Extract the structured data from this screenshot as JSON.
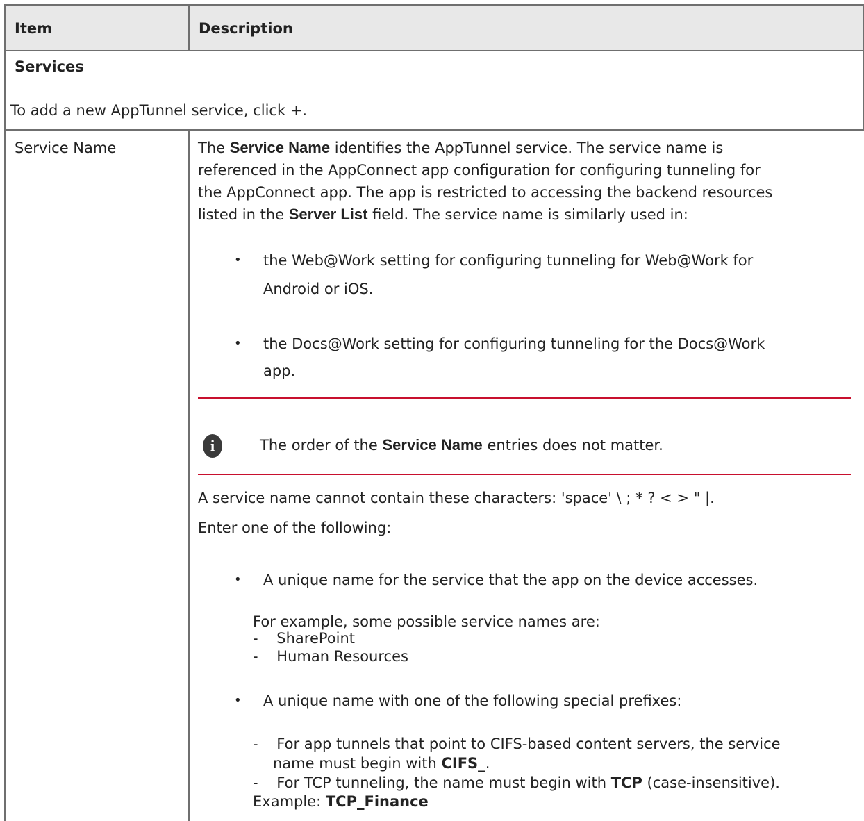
{
  "table": {
    "headers": {
      "item": "Item",
      "description": "Description"
    },
    "section": {
      "title": "Services",
      "subtitle": "To add a new AppTunnel service, click +."
    },
    "row": {
      "item": "Service Name",
      "para1": {
        "t1": "The ",
        "b1": "Service Name",
        "t2": " identifies the AppTunnel service. The service name is",
        "line2": "referenced in the AppConnect app configuration for configuring tunneling for",
        "line3": "the AppConnect app. The app is restricted to accessing the backend resources",
        "t3": "listed in the ",
        "b2": "Server List",
        "t4": " field. The service name is similarly used in:"
      },
      "bullets": [
        {
          "line1": "the Web@Work setting for configuring tunneling for Web@Work for",
          "line2": "Android or iOS."
        },
        {
          "line1": "the Docs@Work setting for configuring tunneling for the Docs@Work",
          "line2": "app."
        }
      ],
      "note": {
        "t1": "The order of the ",
        "b1": "Service Name",
        "t2": " entries does not matter."
      },
      "chars_line": "A service name cannot contain these characters: 'space' \\ ; * ? < > \" |.",
      "enter_line": "Enter one of the following:",
      "option1": "A unique name for the service that the app on the device accesses.",
      "example_intro": "For example, some possible service names are:",
      "examples": [
        "SharePoint",
        "Human Resources"
      ],
      "option2": "A unique name with one of the following special prefixes:",
      "cifs": {
        "line1": "For app tunnels that point to CIFS-based content servers, the service",
        "line2a": "name must begin with ",
        "line2b": "CIFS",
        "line2c": "_."
      },
      "tcp": {
        "t1": "For TCP tunneling, the name must begin with ",
        "b1": "TCP",
        "t2": " (case-insensitive)."
      },
      "example_final": {
        "t1": "Example: ",
        "b1": "TCP_Finance"
      }
    }
  }
}
